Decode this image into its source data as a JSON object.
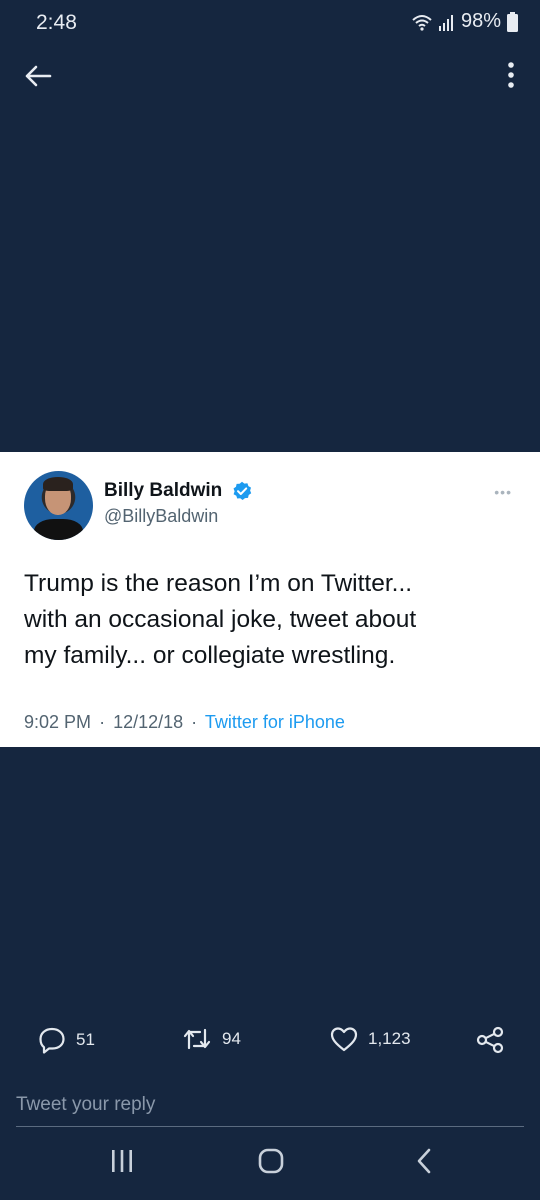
{
  "status_bar": {
    "time": "2:48",
    "battery": "98%"
  },
  "tweet": {
    "display_name": "Billy Baldwin",
    "handle": "@BillyBaldwin",
    "text_lines": [
      "Trump is the reason I’m on Twitter...",
      "with an occasional joke, tweet about",
      "my family... or collegiate wrestling."
    ],
    "time": "9:02 PM",
    "date": "12/12/18",
    "source": "Twitter for iPhone",
    "separator": "·"
  },
  "actions": {
    "replies": "51",
    "retweets": "94",
    "likes": "1,123"
  },
  "reply_box": {
    "placeholder": "Tweet your reply"
  },
  "colors": {
    "background": "#15263f",
    "card": "#ffffff",
    "link": "#1d9bf0",
    "verified": "#1d9bf0"
  },
  "icons": [
    "back-arrow-icon",
    "more-vertical-icon",
    "verified-icon",
    "reply-icon",
    "retweet-icon",
    "like-icon",
    "share-icon",
    "wifi-icon",
    "signal-icon",
    "battery-icon",
    "recent-apps-icon",
    "home-icon",
    "nav-back-icon"
  ]
}
